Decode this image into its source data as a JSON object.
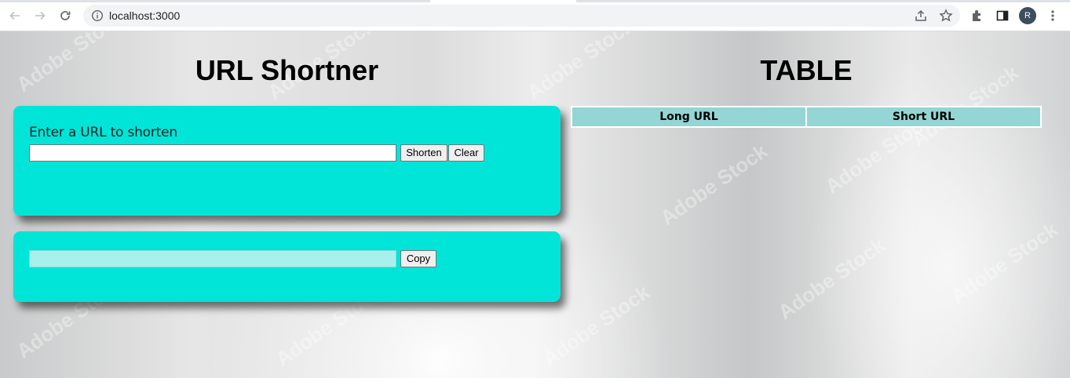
{
  "browser": {
    "url": "localhost:3000",
    "avatar_letter": "R"
  },
  "shortener": {
    "title": "URL Shortner",
    "input_label": "Enter a URL to shorten",
    "input_value": "",
    "shorten_label": "Shorten",
    "clear_label": "Clear",
    "output_value": "",
    "copy_label": "Copy"
  },
  "table": {
    "title": "TABLE",
    "columns": [
      "Long URL",
      "Short URL"
    ],
    "rows": []
  },
  "colors": {
    "card": "#00e5d8",
    "table_header": "#94d5d5",
    "output_field": "#a8f0ec"
  },
  "icons": [
    "back-arrow-icon",
    "forward-arrow-icon",
    "reload-icon",
    "info-icon",
    "share-icon",
    "star-icon",
    "extensions-icon",
    "side-panel-icon",
    "more-vert-icon"
  ]
}
